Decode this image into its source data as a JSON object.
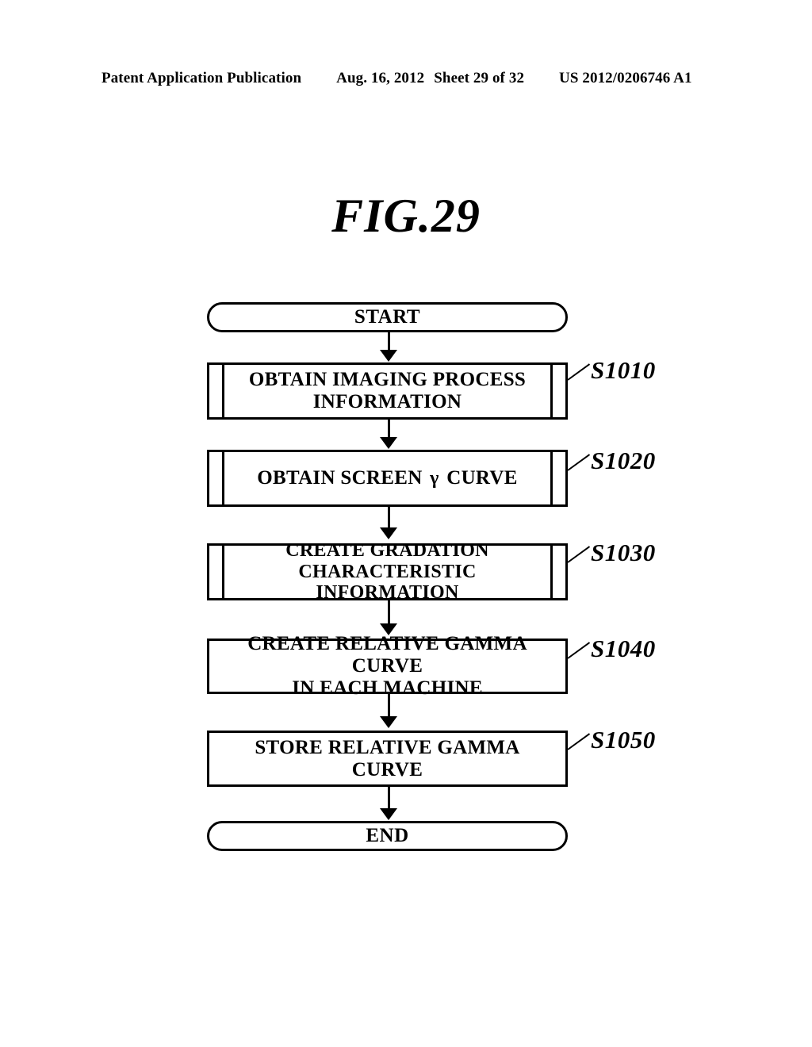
{
  "header": {
    "publication": "Patent Application Publication",
    "date": "Aug. 16, 2012",
    "sheet": "Sheet 29 of 32",
    "document_number": "US 2012/0206746 A1"
  },
  "figure": {
    "title": "FIG.29"
  },
  "flowchart": {
    "start": {
      "label": "START",
      "shape": "terminator"
    },
    "end": {
      "label": "END",
      "shape": "terminator"
    },
    "steps": [
      {
        "ref": "S1010",
        "shape": "predefined-process",
        "lines": [
          "OBTAIN IMAGING PROCESS",
          "INFORMATION"
        ]
      },
      {
        "ref": "S1020",
        "shape": "predefined-process",
        "lines": [
          "OBTAIN SCREEN γ CURVE"
        ]
      },
      {
        "ref": "S1030",
        "shape": "predefined-process",
        "lines": [
          "CREATE GRADATION CHARACTERISTIC",
          "INFORMATION"
        ]
      },
      {
        "ref": "S1040",
        "shape": "process",
        "lines": [
          "CREATE RELATIVE GAMMA CURVE",
          "IN EACH MACHINE"
        ]
      },
      {
        "ref": "S1050",
        "shape": "process",
        "lines": [
          "STORE RELATIVE GAMMA CURVE"
        ]
      }
    ]
  },
  "colors": {
    "ink": "#000000",
    "paper": "#ffffff"
  }
}
